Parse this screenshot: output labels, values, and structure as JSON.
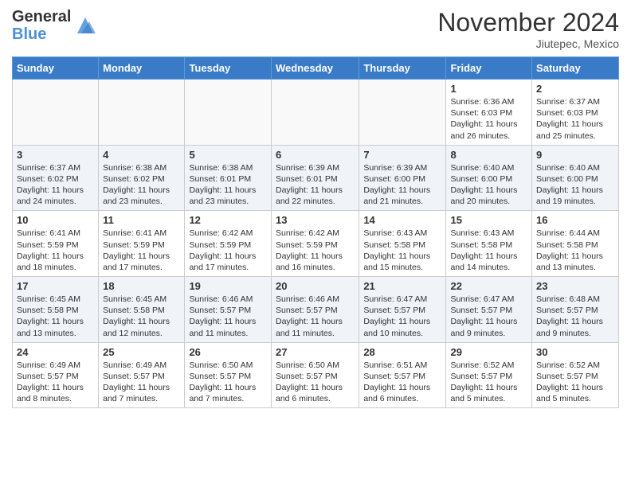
{
  "header": {
    "logo_general": "General",
    "logo_blue": "Blue",
    "month_title": "November 2024",
    "location": "Jiutepec, Mexico"
  },
  "days_of_week": [
    "Sunday",
    "Monday",
    "Tuesday",
    "Wednesday",
    "Thursday",
    "Friday",
    "Saturday"
  ],
  "weeks": [
    [
      {
        "day": "",
        "info": ""
      },
      {
        "day": "",
        "info": ""
      },
      {
        "day": "",
        "info": ""
      },
      {
        "day": "",
        "info": ""
      },
      {
        "day": "",
        "info": ""
      },
      {
        "day": "1",
        "info": "Sunrise: 6:36 AM\nSunset: 6:03 PM\nDaylight: 11 hours and 26 minutes."
      },
      {
        "day": "2",
        "info": "Sunrise: 6:37 AM\nSunset: 6:03 PM\nDaylight: 11 hours and 25 minutes."
      }
    ],
    [
      {
        "day": "3",
        "info": "Sunrise: 6:37 AM\nSunset: 6:02 PM\nDaylight: 11 hours and 24 minutes."
      },
      {
        "day": "4",
        "info": "Sunrise: 6:38 AM\nSunset: 6:02 PM\nDaylight: 11 hours and 23 minutes."
      },
      {
        "day": "5",
        "info": "Sunrise: 6:38 AM\nSunset: 6:01 PM\nDaylight: 11 hours and 23 minutes."
      },
      {
        "day": "6",
        "info": "Sunrise: 6:39 AM\nSunset: 6:01 PM\nDaylight: 11 hours and 22 minutes."
      },
      {
        "day": "7",
        "info": "Sunrise: 6:39 AM\nSunset: 6:00 PM\nDaylight: 11 hours and 21 minutes."
      },
      {
        "day": "8",
        "info": "Sunrise: 6:40 AM\nSunset: 6:00 PM\nDaylight: 11 hours and 20 minutes."
      },
      {
        "day": "9",
        "info": "Sunrise: 6:40 AM\nSunset: 6:00 PM\nDaylight: 11 hours and 19 minutes."
      }
    ],
    [
      {
        "day": "10",
        "info": "Sunrise: 6:41 AM\nSunset: 5:59 PM\nDaylight: 11 hours and 18 minutes."
      },
      {
        "day": "11",
        "info": "Sunrise: 6:41 AM\nSunset: 5:59 PM\nDaylight: 11 hours and 17 minutes."
      },
      {
        "day": "12",
        "info": "Sunrise: 6:42 AM\nSunset: 5:59 PM\nDaylight: 11 hours and 17 minutes."
      },
      {
        "day": "13",
        "info": "Sunrise: 6:42 AM\nSunset: 5:59 PM\nDaylight: 11 hours and 16 minutes."
      },
      {
        "day": "14",
        "info": "Sunrise: 6:43 AM\nSunset: 5:58 PM\nDaylight: 11 hours and 15 minutes."
      },
      {
        "day": "15",
        "info": "Sunrise: 6:43 AM\nSunset: 5:58 PM\nDaylight: 11 hours and 14 minutes."
      },
      {
        "day": "16",
        "info": "Sunrise: 6:44 AM\nSunset: 5:58 PM\nDaylight: 11 hours and 13 minutes."
      }
    ],
    [
      {
        "day": "17",
        "info": "Sunrise: 6:45 AM\nSunset: 5:58 PM\nDaylight: 11 hours and 13 minutes."
      },
      {
        "day": "18",
        "info": "Sunrise: 6:45 AM\nSunset: 5:58 PM\nDaylight: 11 hours and 12 minutes."
      },
      {
        "day": "19",
        "info": "Sunrise: 6:46 AM\nSunset: 5:57 PM\nDaylight: 11 hours and 11 minutes."
      },
      {
        "day": "20",
        "info": "Sunrise: 6:46 AM\nSunset: 5:57 PM\nDaylight: 11 hours and 11 minutes."
      },
      {
        "day": "21",
        "info": "Sunrise: 6:47 AM\nSunset: 5:57 PM\nDaylight: 11 hours and 10 minutes."
      },
      {
        "day": "22",
        "info": "Sunrise: 6:47 AM\nSunset: 5:57 PM\nDaylight: 11 hours and 9 minutes."
      },
      {
        "day": "23",
        "info": "Sunrise: 6:48 AM\nSunset: 5:57 PM\nDaylight: 11 hours and 9 minutes."
      }
    ],
    [
      {
        "day": "24",
        "info": "Sunrise: 6:49 AM\nSunset: 5:57 PM\nDaylight: 11 hours and 8 minutes."
      },
      {
        "day": "25",
        "info": "Sunrise: 6:49 AM\nSunset: 5:57 PM\nDaylight: 11 hours and 7 minutes."
      },
      {
        "day": "26",
        "info": "Sunrise: 6:50 AM\nSunset: 5:57 PM\nDaylight: 11 hours and 7 minutes."
      },
      {
        "day": "27",
        "info": "Sunrise: 6:50 AM\nSunset: 5:57 PM\nDaylight: 11 hours and 6 minutes."
      },
      {
        "day": "28",
        "info": "Sunrise: 6:51 AM\nSunset: 5:57 PM\nDaylight: 11 hours and 6 minutes."
      },
      {
        "day": "29",
        "info": "Sunrise: 6:52 AM\nSunset: 5:57 PM\nDaylight: 11 hours and 5 minutes."
      },
      {
        "day": "30",
        "info": "Sunrise: 6:52 AM\nSunset: 5:57 PM\nDaylight: 11 hours and 5 minutes."
      }
    ]
  ]
}
